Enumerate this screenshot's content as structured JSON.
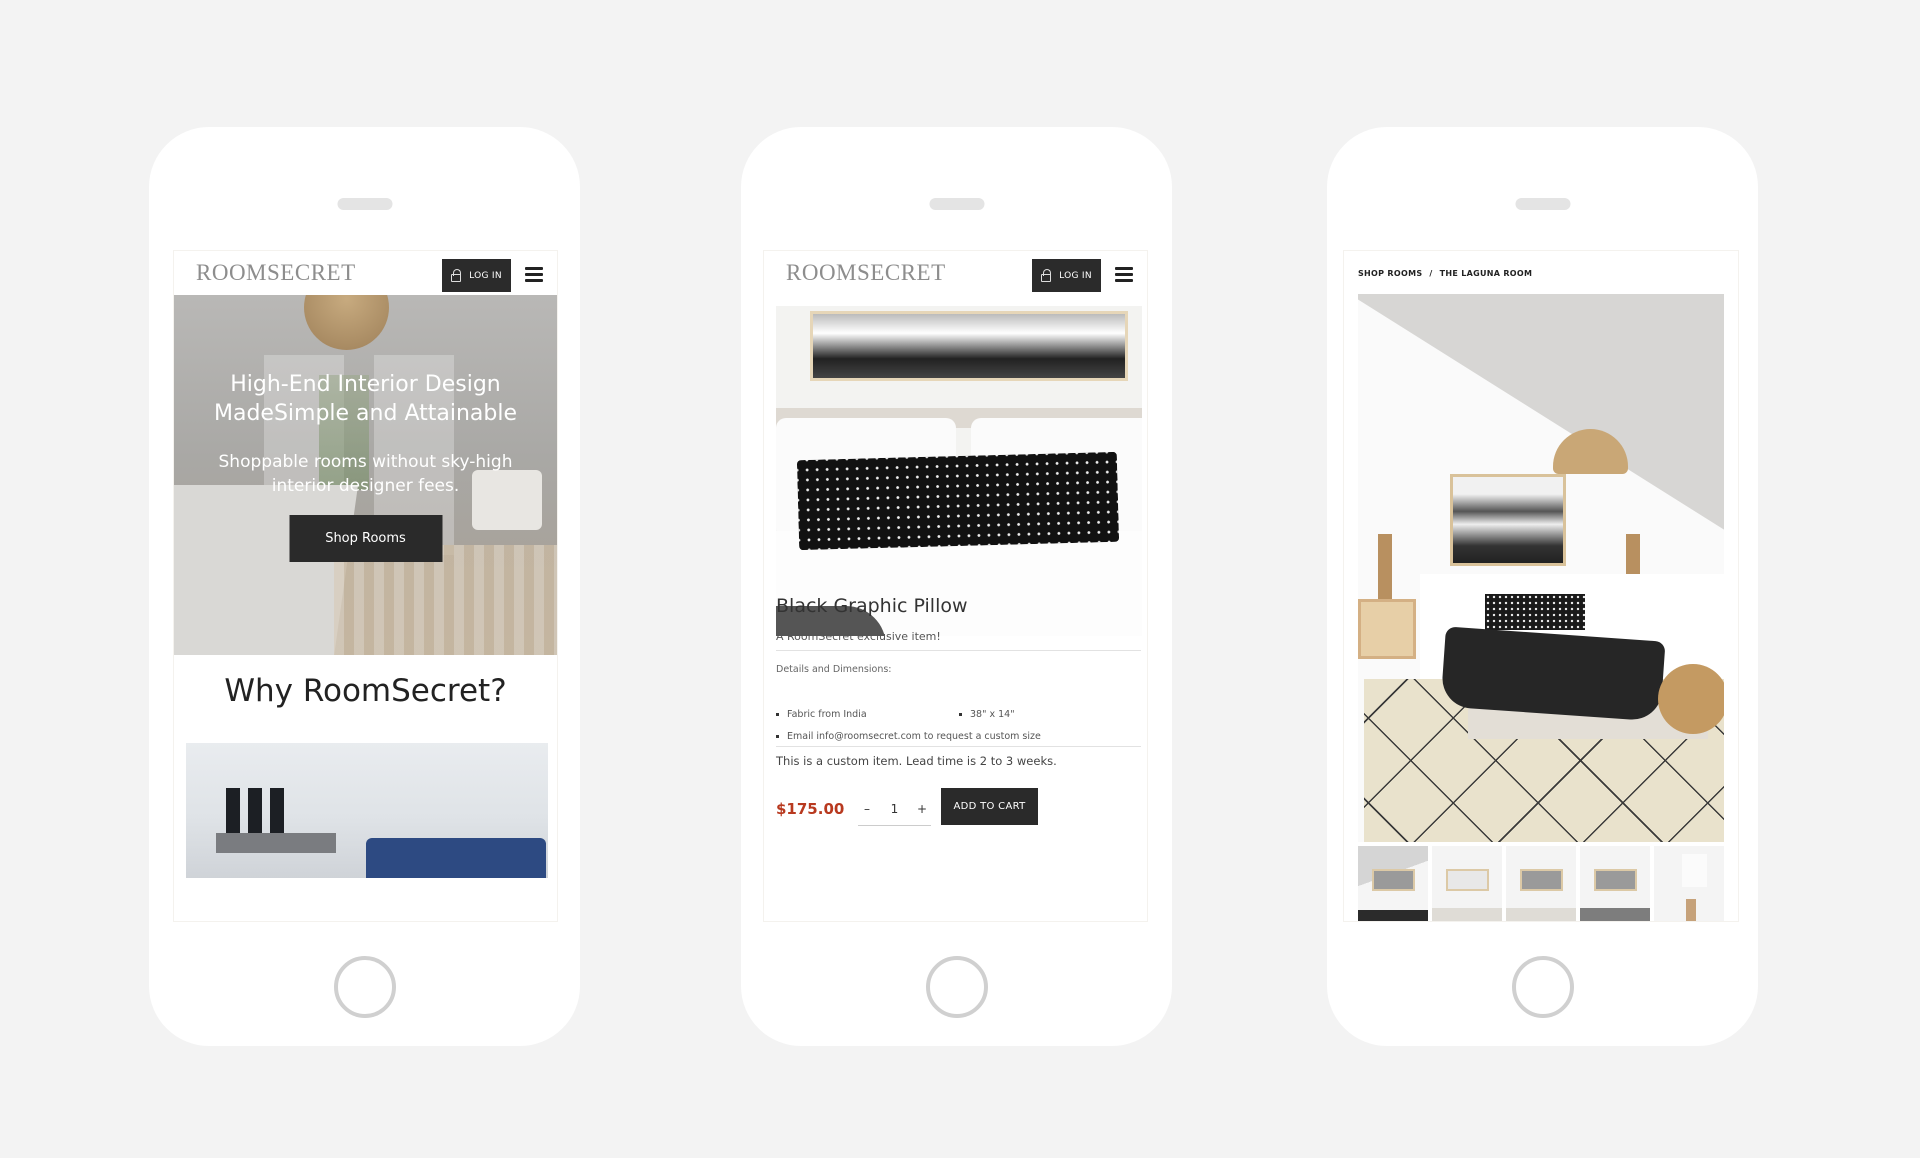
{
  "brand": {
    "logo": "ROOMSECRET"
  },
  "header": {
    "login_label": "LOG IN",
    "login_icon": "lock-icon",
    "menu_icon": "hamburger-icon"
  },
  "home": {
    "hero_title_line1": "High-End Interior Design",
    "hero_title_line2": "MadeSimple and Attainable",
    "hero_sub_line1": "Shoppable rooms without sky-high",
    "hero_sub_line2": "interior designer fees.",
    "shop_button": "Shop Rooms",
    "why_heading": "Why RoomSecret?"
  },
  "product": {
    "title": "Black Graphic Pillow",
    "subtitle": "A RoomSecret exclusive item!",
    "details_label": "Details and Dimensions:",
    "bullets": [
      "Fabric from India",
      "38\" x 14\"",
      "Email info@roomsecret.com to request a custom size"
    ],
    "lead_time": "This is a custom item. Lead time is 2 to 3 weeks.",
    "price": "$175.00",
    "qty_minus": "–",
    "qty_value": "1",
    "qty_plus": "+",
    "add_to_cart": "ADD TO CART",
    "price_color": "#b8391f"
  },
  "room": {
    "breadcrumb": [
      "SHOP ROOMS",
      "THE LAGUNA ROOM"
    ],
    "breadcrumb_sep": "/",
    "thumbnail_count": 5
  }
}
